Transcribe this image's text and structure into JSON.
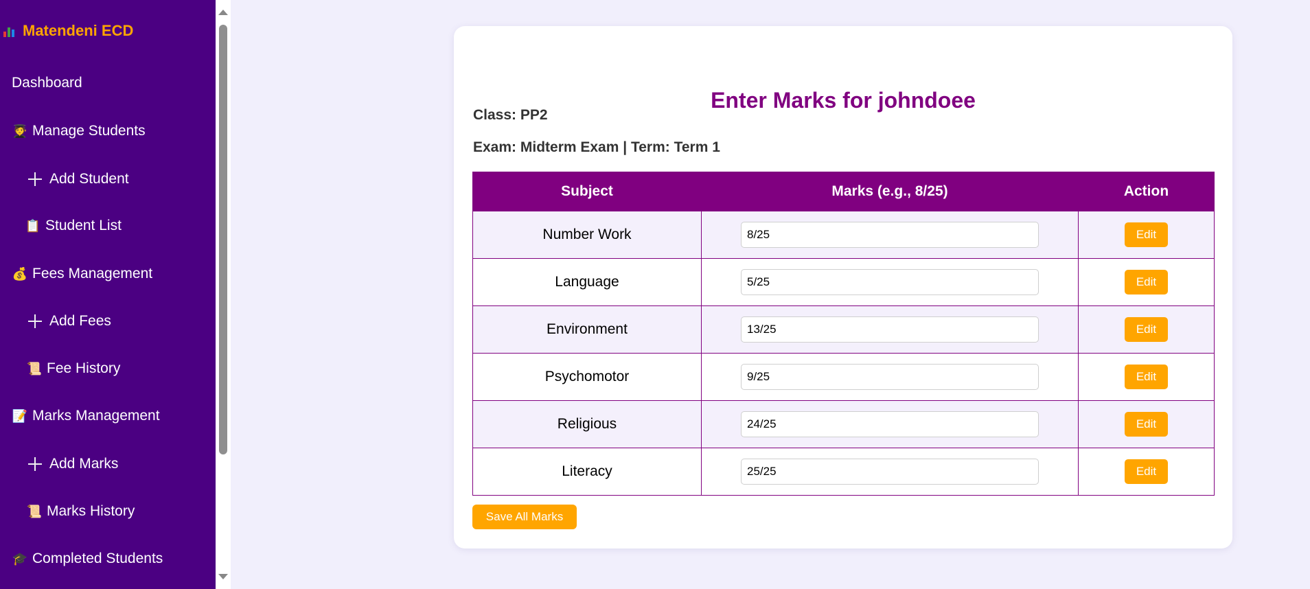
{
  "brand": {
    "name": "Matendeni ECD",
    "icon": "bar-chart-icon"
  },
  "nav": [
    {
      "label": "Dashboard",
      "icon": ""
    },
    {
      "label": "Manage Students",
      "icon": "🧑‍🎓"
    },
    {
      "label": "Add Student",
      "icon": "plus-icon"
    },
    {
      "label": "Student List",
      "icon": "📋"
    },
    {
      "label": "Fees Management",
      "icon": "💰"
    },
    {
      "label": "Add Fees",
      "icon": "plus-icon"
    },
    {
      "label": "Fee History",
      "icon": "📜"
    },
    {
      "label": "Marks Management",
      "icon": "📝"
    },
    {
      "label": "Add Marks",
      "icon": "plus-icon"
    },
    {
      "label": "Marks History",
      "icon": "📜"
    },
    {
      "label": "Completed Students",
      "icon": "🎓"
    }
  ],
  "page": {
    "title": "Enter Marks for johndoee",
    "class_line": "Class: PP2",
    "exam_line": "Exam: Midterm Exam | Term: Term 1"
  },
  "table": {
    "headers": [
      "Subject",
      "Marks (e.g., 8/25)",
      "Action"
    ],
    "rows": [
      {
        "subject": "Number Work",
        "marks": "8/25",
        "action": "Edit"
      },
      {
        "subject": "Language",
        "marks": "5/25",
        "action": "Edit"
      },
      {
        "subject": "Environment",
        "marks": "13/25",
        "action": "Edit"
      },
      {
        "subject": "Psychomotor",
        "marks": "9/25",
        "action": "Edit"
      },
      {
        "subject": "Religious",
        "marks": "24/25",
        "action": "Edit"
      },
      {
        "subject": "Literacy",
        "marks": "25/25",
        "action": "Edit"
      }
    ]
  },
  "save_label": "Save All Marks",
  "colors": {
    "sidebar": "#4b0082",
    "brand": "#ffa500",
    "accent": "#800080",
    "button": "#ffa500",
    "background": "#f1effc"
  }
}
